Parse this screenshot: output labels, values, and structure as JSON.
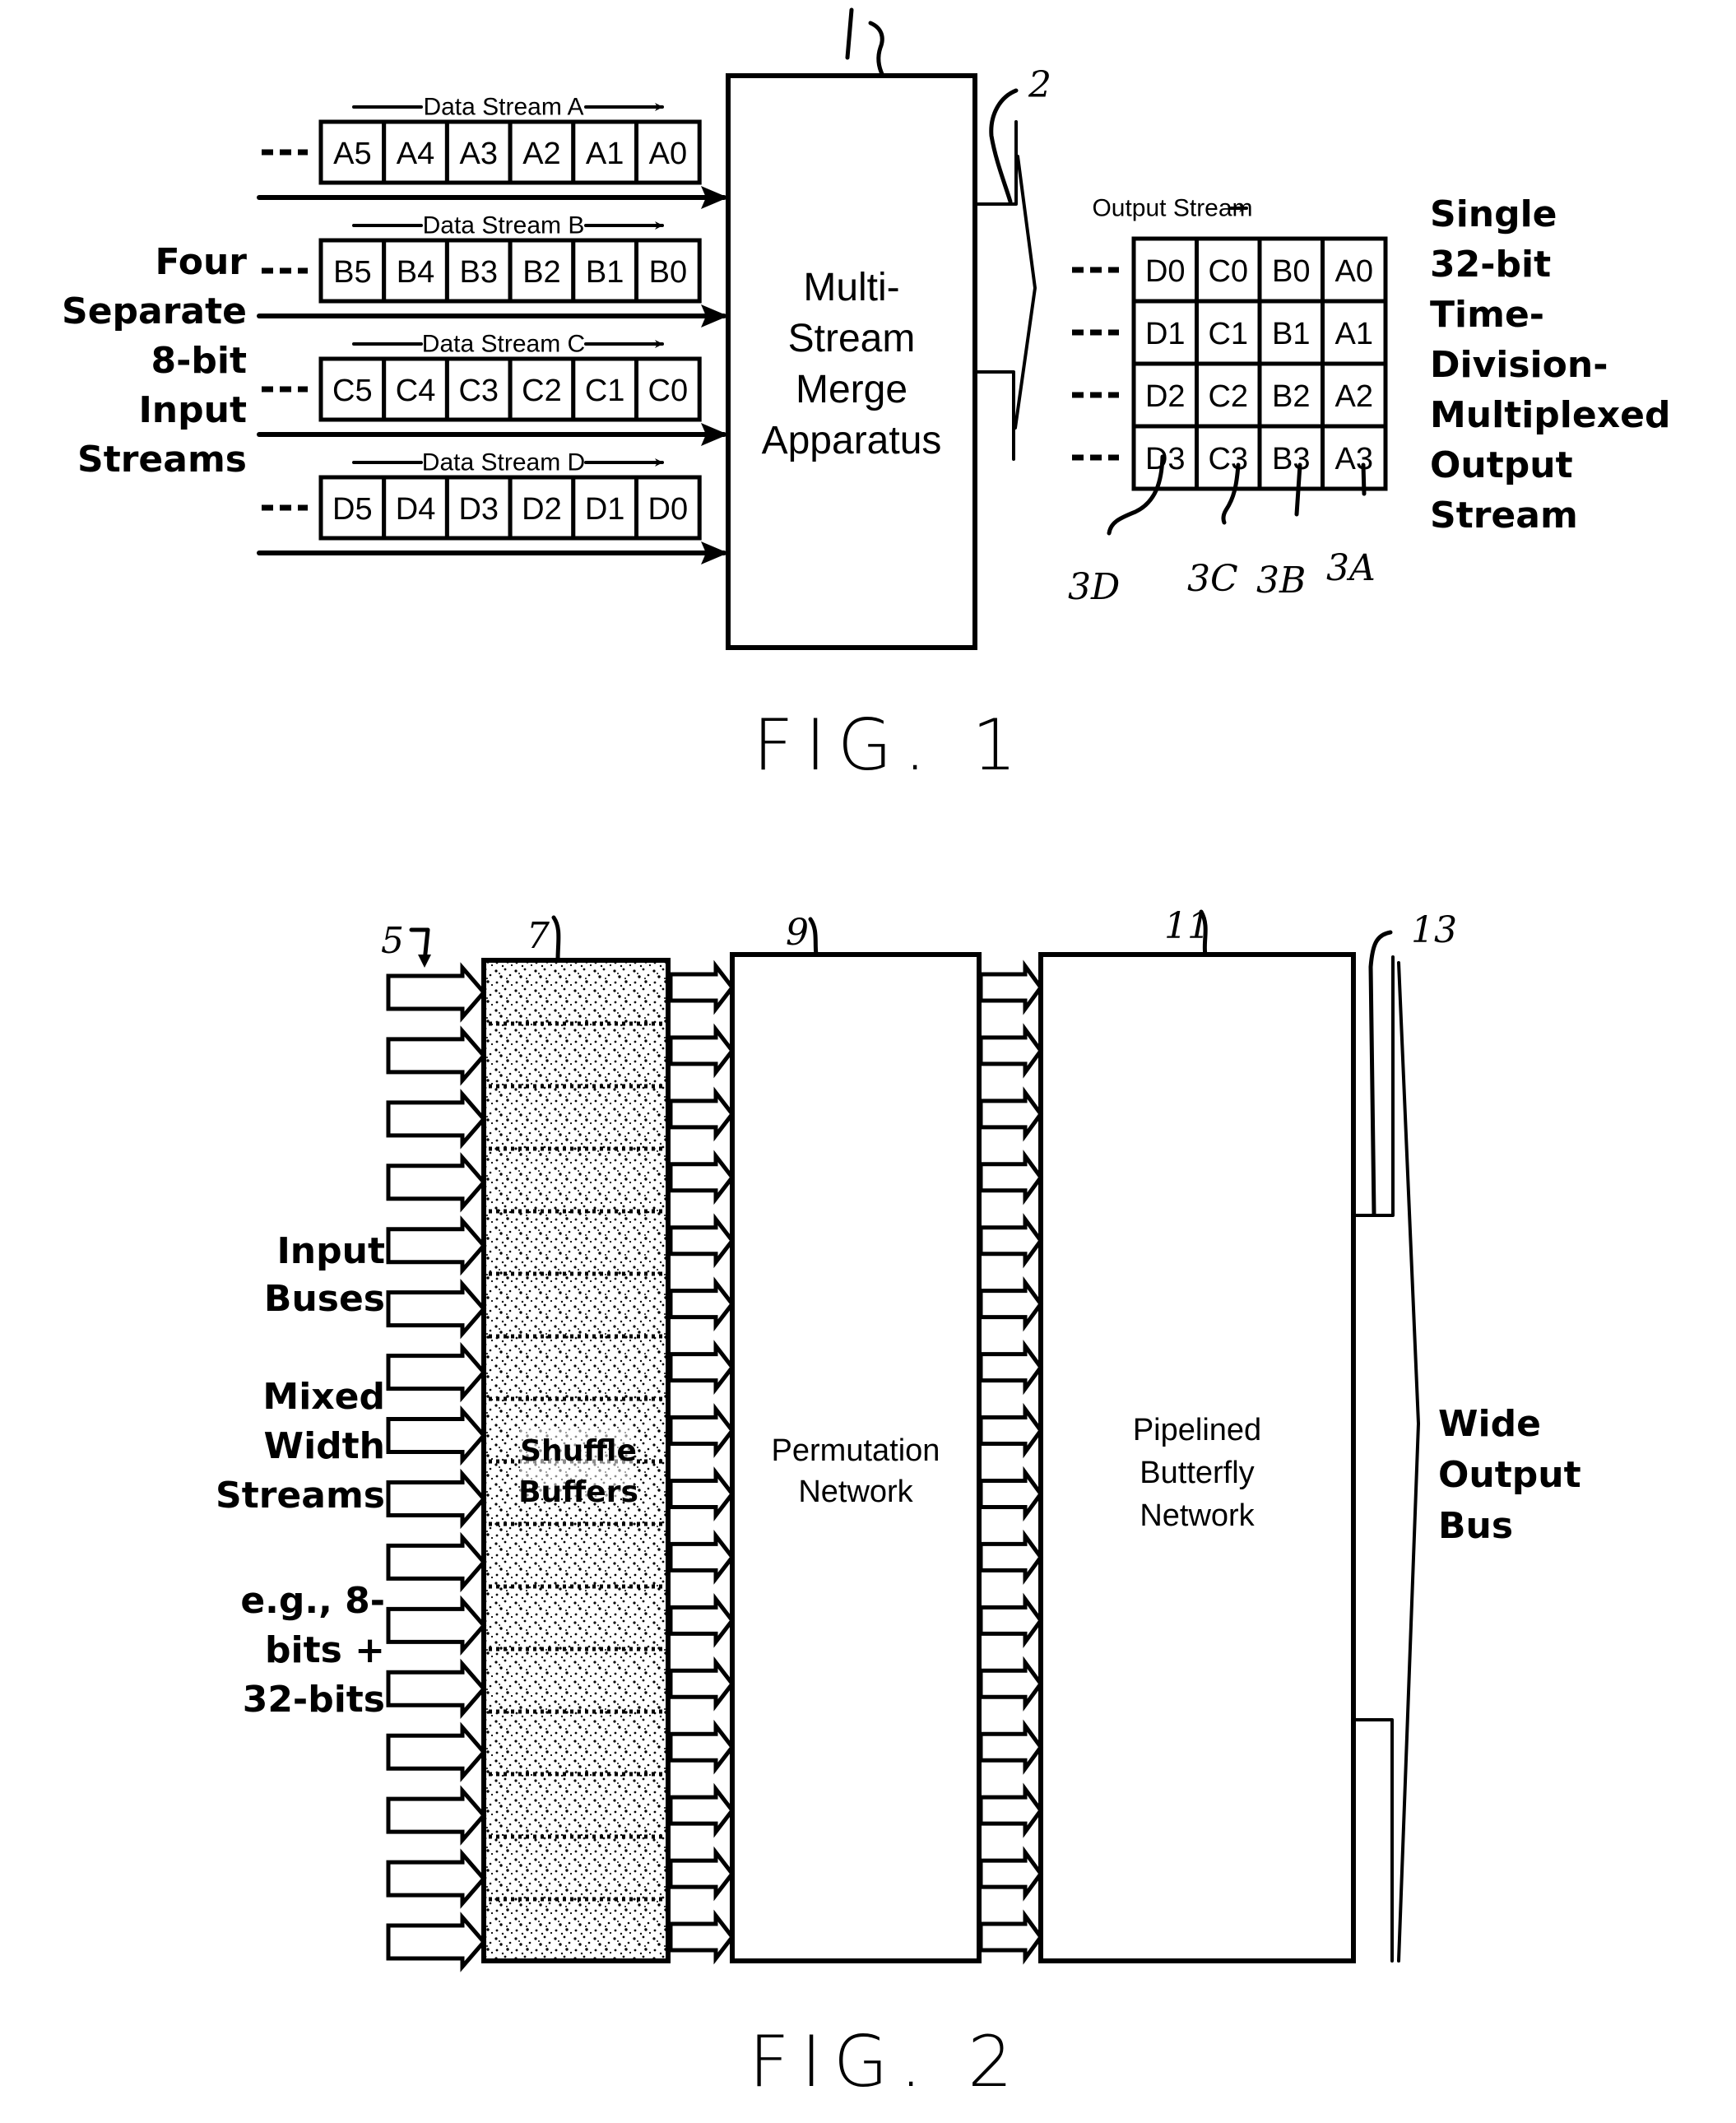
{
  "figure1": {
    "caption": "FIG. 1",
    "left_label": [
      "Four",
      "Separate",
      "8-bit",
      "Input",
      "Streams"
    ],
    "input_streams": [
      {
        "label": "Data Stream A",
        "cells": [
          "A5",
          "A4",
          "A3",
          "A2",
          "A1",
          "A0"
        ]
      },
      {
        "label": "Data Stream B",
        "cells": [
          "B5",
          "B4",
          "B3",
          "B2",
          "B1",
          "B0"
        ]
      },
      {
        "label": "Data Stream C",
        "cells": [
          "C5",
          "C4",
          "C3",
          "C2",
          "C1",
          "C0"
        ]
      },
      {
        "label": "Data Stream D",
        "cells": [
          "D5",
          "D4",
          "D3",
          "D2",
          "D1",
          "D0"
        ]
      }
    ],
    "continuation_marker": "---",
    "merge_box": {
      "lines": [
        "Multi-",
        "Stream",
        "Merge",
        "Apparatus"
      ],
      "ref": "1"
    },
    "output_ref": "2",
    "output_stream": {
      "label": "Output Stream",
      "rows": [
        [
          "D0",
          "C0",
          "B0",
          "A0"
        ],
        [
          "D1",
          "C1",
          "B1",
          "A1"
        ],
        [
          "D2",
          "C2",
          "B2",
          "A2"
        ],
        [
          "D3",
          "C3",
          "B3",
          "A3"
        ]
      ],
      "column_refs": [
        "3D",
        "3C",
        "3B",
        "3A"
      ]
    },
    "right_label": [
      "Single",
      "32-bit",
      "Time-",
      "Division-",
      "Multiplexed",
      "Output",
      "Stream"
    ]
  },
  "figure2": {
    "caption": "FIG. 2",
    "refs": {
      "input_buses": "5",
      "shuffle": "7",
      "permutation": "9",
      "butterfly": "11",
      "output": "13"
    },
    "left_label_groups": [
      [
        "Input",
        "Buses"
      ],
      [
        "Mixed",
        "Width",
        "Streams"
      ],
      [
        "e.g., 8-",
        "bits +",
        "32-bits"
      ]
    ],
    "input_bus_count": 16,
    "shuffle_box": {
      "lines": [
        "Shuffle",
        "Buffers"
      ],
      "segments": 15
    },
    "permutation_box": {
      "lines": [
        "Permutation",
        "Network"
      ]
    },
    "butterfly_box": {
      "lines": [
        "Pipelined",
        "Butterfly",
        "Network"
      ]
    },
    "output_label": [
      "Wide",
      "Output",
      "Bus"
    ]
  }
}
